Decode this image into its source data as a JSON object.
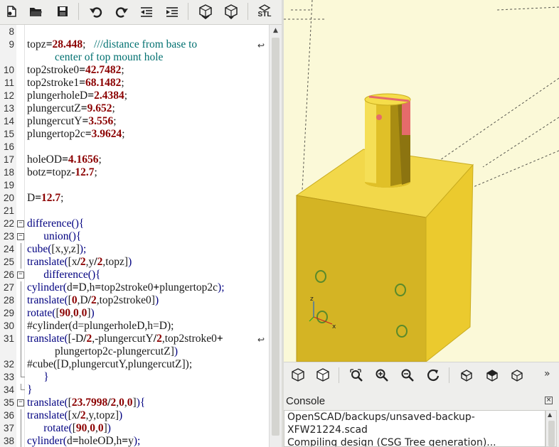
{
  "toolbar": {
    "buttons": [
      {
        "name": "new-file-icon"
      },
      {
        "name": "open-file-icon"
      },
      {
        "name": "save-file-icon"
      },
      {
        "name": "undo-icon"
      },
      {
        "name": "redo-icon"
      },
      {
        "name": "unindent-icon"
      },
      {
        "name": "indent-icon"
      },
      {
        "name": "preview-icon"
      },
      {
        "name": "render-icon"
      }
    ],
    "export_label": "STL"
  },
  "editor": {
    "lines": [
      {
        "n": "8",
        "tokens": []
      },
      {
        "n": "9",
        "tokens": [
          [
            "",
            "topz"
          ],
          [
            "op",
            "="
          ],
          [
            "num",
            "28.448"
          ],
          [
            "",
            ";   "
          ],
          [
            "cmt",
            "///distance from base to"
          ]
        ],
        "wrap": true
      },
      {
        "n": "",
        "tokens": [
          [
            "cmt",
            "center of top mount hole"
          ]
        ],
        "cont": true
      },
      {
        "n": "10",
        "tokens": [
          [
            "",
            "top2stroke0"
          ],
          [
            "op",
            "="
          ],
          [
            "num",
            "42.7482"
          ],
          [
            "",
            ";"
          ]
        ]
      },
      {
        "n": "11",
        "tokens": [
          [
            "",
            "top2stroke1"
          ],
          [
            "op",
            "="
          ],
          [
            "num",
            "68.1482"
          ],
          [
            "",
            ";"
          ]
        ]
      },
      {
        "n": "12",
        "tokens": [
          [
            "",
            "plungerholeD"
          ],
          [
            "op",
            "="
          ],
          [
            "num",
            "2.4384"
          ],
          [
            "",
            ";"
          ]
        ]
      },
      {
        "n": "13",
        "tokens": [
          [
            "",
            "plungercutZ"
          ],
          [
            "op",
            "="
          ],
          [
            "num",
            "9.652"
          ],
          [
            "",
            ";"
          ]
        ]
      },
      {
        "n": "14",
        "tokens": [
          [
            "",
            "plungercutY"
          ],
          [
            "op",
            "="
          ],
          [
            "num",
            "3.556"
          ],
          [
            "",
            ";"
          ]
        ]
      },
      {
        "n": "15",
        "tokens": [
          [
            "",
            "plungertop2c"
          ],
          [
            "op",
            "="
          ],
          [
            "num",
            "3.9624"
          ],
          [
            "",
            ";"
          ]
        ]
      },
      {
        "n": "16",
        "tokens": []
      },
      {
        "n": "17",
        "tokens": [
          [
            "",
            "holeOD"
          ],
          [
            "op",
            "="
          ],
          [
            "num",
            "4.1656"
          ],
          [
            "",
            ";"
          ]
        ]
      },
      {
        "n": "18",
        "tokens": [
          [
            "",
            "botz"
          ],
          [
            "op",
            "="
          ],
          [
            "",
            "topz"
          ],
          [
            "op",
            "-"
          ],
          [
            "num",
            "12.7"
          ],
          [
            "",
            ";"
          ]
        ]
      },
      {
        "n": "19",
        "tokens": []
      },
      {
        "n": "20",
        "tokens": [
          [
            "",
            "D"
          ],
          [
            "op",
            "="
          ],
          [
            "num",
            "12.7"
          ],
          [
            "",
            ";"
          ]
        ]
      },
      {
        "n": "21",
        "tokens": []
      },
      {
        "n": "22",
        "tokens": [
          [
            "kw",
            "difference(){"
          ]
        ],
        "fold": "open"
      },
      {
        "n": "23",
        "tokens": [
          [
            "kw",
            "      union(){"
          ]
        ],
        "fold": "open"
      },
      {
        "n": "24",
        "tokens": [
          [
            "kw",
            "cube("
          ],
          [
            "",
            "[x,y,z]"
          ],
          [
            "kw",
            ");"
          ]
        ],
        "fold": "line"
      },
      {
        "n": "25",
        "tokens": [
          [
            "kw",
            "translate("
          ],
          [
            "",
            "[x"
          ],
          [
            "op",
            "/"
          ],
          [
            "num",
            "2"
          ],
          [
            "",
            ",y"
          ],
          [
            "op",
            "/"
          ],
          [
            "num",
            "2"
          ],
          [
            "",
            ",topz]"
          ],
          [
            "kw",
            ")"
          ]
        ],
        "fold": "line"
      },
      {
        "n": "26",
        "tokens": [
          [
            "kw",
            "      difference(){"
          ]
        ],
        "fold": "open"
      },
      {
        "n": "27",
        "tokens": [
          [
            "kw",
            "cylinder("
          ],
          [
            "",
            "d"
          ],
          [
            "op",
            "="
          ],
          [
            "",
            "D,h"
          ],
          [
            "op",
            "="
          ],
          [
            "",
            "top2stroke0"
          ],
          [
            "op",
            "+"
          ],
          [
            "",
            "plungertop2c"
          ],
          [
            "kw",
            ");"
          ]
        ],
        "fold": "line"
      },
      {
        "n": "28",
        "tokens": [
          [
            "kw",
            "translate("
          ],
          [
            "",
            "["
          ],
          [
            "num",
            "0"
          ],
          [
            "",
            ",D"
          ],
          [
            "op",
            "/"
          ],
          [
            "num",
            "2"
          ],
          [
            "",
            ",top2stroke0]"
          ],
          [
            "kw",
            ")"
          ]
        ],
        "fold": "line"
      },
      {
        "n": "29",
        "tokens": [
          [
            "kw",
            "rotate("
          ],
          [
            "",
            "["
          ],
          [
            "num",
            "90"
          ],
          [
            "",
            ","
          ],
          [
            "num",
            "0"
          ],
          [
            "",
            ","
          ],
          [
            "num",
            "0"
          ],
          [
            "",
            "]"
          ],
          [
            "kw",
            ")"
          ]
        ],
        "fold": "line"
      },
      {
        "n": "30",
        "tokens": [
          [
            "",
            "#cylinder(d=plungerholeD,h=D);"
          ]
        ],
        "fold": "line"
      },
      {
        "n": "31",
        "tokens": [
          [
            "kw",
            "translate("
          ],
          [
            "",
            "[-D"
          ],
          [
            "op",
            "/"
          ],
          [
            "num",
            "2"
          ],
          [
            "",
            ",-plungercutY"
          ],
          [
            "op",
            "/"
          ],
          [
            "num",
            "2"
          ],
          [
            "",
            ",top2stroke0"
          ],
          [
            "op",
            "+"
          ]
        ],
        "fold": "line",
        "wrap": true
      },
      {
        "n": "",
        "tokens": [
          [
            "",
            "plungertop2c-plungercutZ]"
          ],
          [
            "kw",
            ")"
          ]
        ],
        "cont": true,
        "fold": "line"
      },
      {
        "n": "32",
        "tokens": [
          [
            "",
            "#cube([D,plungercutY,plungercutZ]);"
          ]
        ],
        "fold": "line"
      },
      {
        "n": "33",
        "tokens": [
          [
            "kw",
            "      }"
          ]
        ],
        "fold": "end"
      },
      {
        "n": "34",
        "tokens": [
          [
            "kw",
            "}"
          ]
        ],
        "fold": "end"
      },
      {
        "n": "35",
        "tokens": [
          [
            "kw",
            "translate("
          ],
          [
            "",
            "["
          ],
          [
            "num",
            "23.7998"
          ],
          [
            "op",
            "/"
          ],
          [
            "num",
            "2"
          ],
          [
            "",
            ","
          ],
          [
            "num",
            "0"
          ],
          [
            "",
            ","
          ],
          [
            "num",
            "0"
          ],
          [
            "",
            "]"
          ],
          [
            "kw",
            "){"
          ]
        ],
        "fold": "open"
      },
      {
        "n": "36",
        "tokens": [
          [
            "kw",
            "translate("
          ],
          [
            "",
            "[x"
          ],
          [
            "op",
            "/"
          ],
          [
            "num",
            "2"
          ],
          [
            "",
            ",y,topz]"
          ],
          [
            "kw",
            ")"
          ]
        ],
        "fold": "line"
      },
      {
        "n": "37",
        "tokens": [
          [
            "kw",
            "      rotate("
          ],
          [
            "",
            "["
          ],
          [
            "num",
            "90"
          ],
          [
            "",
            ","
          ],
          [
            "num",
            "0"
          ],
          [
            "",
            ","
          ],
          [
            "num",
            "0"
          ],
          [
            "",
            "]"
          ],
          [
            "kw",
            ")"
          ]
        ],
        "fold": "line"
      },
      {
        "n": "38",
        "tokens": [
          [
            "kw",
            "cylinder("
          ],
          [
            "",
            "d"
          ],
          [
            "op",
            "="
          ],
          [
            "",
            "holeOD,h"
          ],
          [
            "op",
            "="
          ],
          [
            "",
            "y"
          ],
          [
            "kw",
            ");"
          ]
        ],
        "fold": "line"
      }
    ]
  },
  "viewport": {
    "axes": {
      "x": "x",
      "z": "z"
    },
    "colors": {
      "background": "#fbf9d8",
      "model": "#e8c82a",
      "highlight": "#e56b6b",
      "axis_x": "#cc2222",
      "axis_z": "#2266cc"
    }
  },
  "viewtoolbar": {
    "buttons": [
      {
        "name": "preview-mode-icon"
      },
      {
        "name": "render-mode-icon"
      },
      {
        "name": "view-all-icon"
      },
      {
        "name": "zoom-in-icon"
      },
      {
        "name": "zoom-out-icon"
      },
      {
        "name": "reset-view-icon"
      },
      {
        "name": "view-right-icon"
      },
      {
        "name": "view-top-icon"
      },
      {
        "name": "view-bottom-icon"
      }
    ],
    "more": "»"
  },
  "console": {
    "title": "Console",
    "close": "×",
    "lines": [
      "OpenSCAD/backups/unsaved-backup-",
      "XFW21224.scad",
      "Compiling design (CSG Tree generation)..."
    ]
  }
}
